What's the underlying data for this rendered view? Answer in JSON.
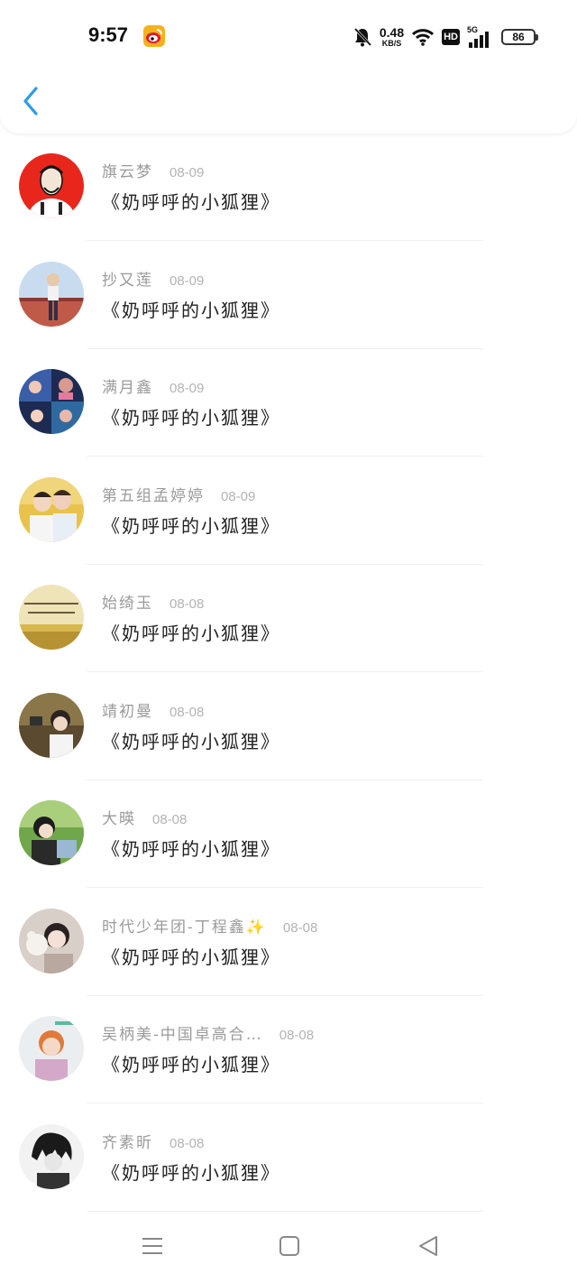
{
  "status": {
    "time": "9:57",
    "net_speed": "0.48",
    "net_unit": "KB/S",
    "hd": "HD",
    "network": "5G",
    "battery": "86"
  },
  "icons": {
    "back": "chevron-left-icon",
    "menu": "menu-icon",
    "home": "home-square-icon",
    "back_nav": "triangle-back-icon"
  },
  "colors": {
    "accent": "#2b9be8",
    "name": "#9a9a9a",
    "date": "#b3b3b3",
    "message": "#222222"
  },
  "items": [
    {
      "name": "旗云梦",
      "date": "08-09",
      "message": "《奶呼呼的小狐狸》"
    },
    {
      "name": "抄又莲",
      "date": "08-09",
      "message": "《奶呼呼的小狐狸》"
    },
    {
      "name": "满月鑫",
      "date": "08-09",
      "message": "《奶呼呼的小狐狸》"
    },
    {
      "name": "第五组孟婷婷",
      "date": "08-09",
      "message": "《奶呼呼的小狐狸》"
    },
    {
      "name": "始绮玉",
      "date": "08-08",
      "message": "《奶呼呼的小狐狸》"
    },
    {
      "name": "靖初曼",
      "date": "08-08",
      "message": "《奶呼呼的小狐狸》"
    },
    {
      "name": "大暎",
      "date": "08-08",
      "message": "《奶呼呼的小狐狸》"
    },
    {
      "name": "时代少年团-丁程鑫✨",
      "date": "08-08",
      "message": "《奶呼呼的小狐狸》"
    },
    {
      "name": "吴柄美-中国卓高合…",
      "date": "08-08",
      "message": "《奶呼呼的小狐狸》"
    },
    {
      "name": "齐素昕",
      "date": "08-08",
      "message": "《奶呼呼的小狐狸》"
    }
  ]
}
